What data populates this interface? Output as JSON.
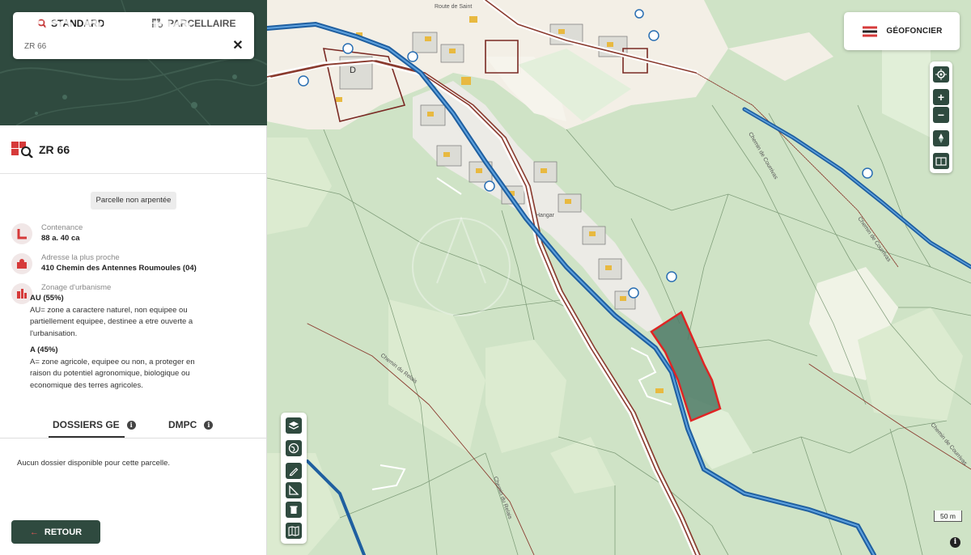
{
  "search": {
    "watermark": "etre proprio",
    "mode_standard": "STANDARD",
    "mode_parcellaire": "PARCELLAIRE",
    "value": "ZR 66",
    "close_icon": "close-icon"
  },
  "parcel": {
    "title": "ZR 66",
    "status": "Parcelle non arpentée",
    "contenance_label": "Contenance",
    "contenance_value": "88 a. 40 ca",
    "adresse_label": "Adresse la plus proche",
    "adresse_value": "410 Chemin des Antennes Roumoules (04)",
    "zonage_label": "Zonage d'urbanisme",
    "zones": [
      {
        "title": "AU (55%)",
        "description": "AU= zone a caractere naturel, non equipee ou partiellement equipee, destinee a etre ouverte a l'urbanisation."
      },
      {
        "title": "A (45%)",
        "description": "A= zone agricole, equipee ou non, a proteger en raison du potentiel agronomique, biologique ou economique des terres agricoles."
      }
    ]
  },
  "tabs": {
    "dossiers": "DOSSIERS GE",
    "dmpc": "DMPC",
    "empty_message": "Aucun dossier disponible pour cette parcelle."
  },
  "retour_label": "RETOUR",
  "brand": {
    "name": "GÉOFONCIER"
  },
  "map": {
    "scale_label": "50 m",
    "parcel_letter": "D",
    "road_labels": [
      "Chemin du Relais",
      "Chemin du Relais",
      "Chemin de Courrivas",
      "Chemin de Courrivas",
      "Chemin de Courrivas",
      "Route de Saint",
      "Hangar"
    ],
    "colors": {
      "forest": "#cfe3c6",
      "field": "#dcebd0",
      "road": "#8a3b2f",
      "river": "#2a6fb3",
      "selected_parcel": "#e02424",
      "panel_dark": "#2f4a3f"
    }
  }
}
